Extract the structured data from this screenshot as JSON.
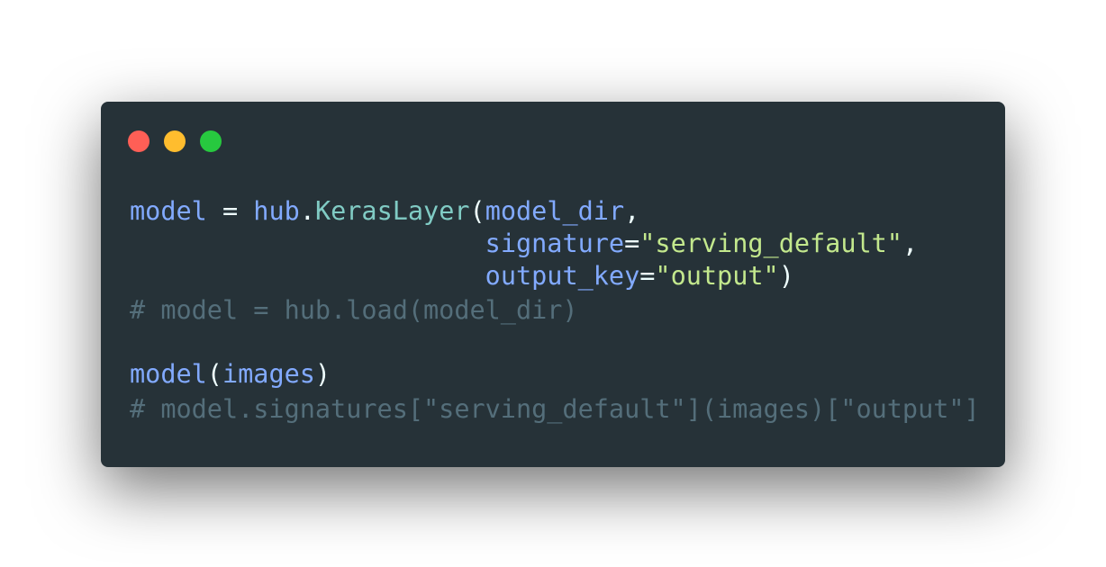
{
  "colors": {
    "background": "#263238",
    "dot_close": "#ff5f56",
    "dot_minimize": "#ffbd2e",
    "dot_maximize": "#27c93f",
    "variable": "#82aaff",
    "class": "#80cbc4",
    "string": "#c3e88d",
    "punctuation": "#eeffff",
    "operator": "#89ddff",
    "comment": "#546e7a"
  },
  "code": {
    "lines": [
      [
        {
          "text": "model",
          "kind": "variable"
        },
        {
          "text": " = ",
          "kind": "punctuation"
        },
        {
          "text": "hub",
          "kind": "variable"
        },
        {
          "text": ".",
          "kind": "punctuation"
        },
        {
          "text": "KerasLayer",
          "kind": "class"
        },
        {
          "text": "(",
          "kind": "punctuation"
        },
        {
          "text": "model_dir",
          "kind": "variable"
        },
        {
          "text": ",",
          "kind": "punctuation"
        }
      ],
      [
        {
          "text": "                       ",
          "kind": "punctuation"
        },
        {
          "text": "signature",
          "kind": "variable"
        },
        {
          "text": "=",
          "kind": "punctuation"
        },
        {
          "text": "\"serving_default\"",
          "kind": "string"
        },
        {
          "text": ",",
          "kind": "punctuation"
        }
      ],
      [
        {
          "text": "                       ",
          "kind": "punctuation"
        },
        {
          "text": "output_key",
          "kind": "variable"
        },
        {
          "text": "=",
          "kind": "punctuation"
        },
        {
          "text": "\"output\"",
          "kind": "string"
        },
        {
          "text": ")",
          "kind": "punctuation"
        }
      ],
      [
        {
          "text": "# model = hub.load(model_dir)",
          "kind": "comment"
        }
      ],
      [
        {
          "text": "model",
          "kind": "variable"
        },
        {
          "text": "(",
          "kind": "punctuation"
        },
        {
          "text": "images",
          "kind": "variable"
        },
        {
          "text": ")",
          "kind": "punctuation"
        }
      ],
      [
        {
          "text": "# model.signatures[\"serving_default\"](images)[\"output\"]",
          "kind": "comment"
        }
      ]
    ]
  }
}
